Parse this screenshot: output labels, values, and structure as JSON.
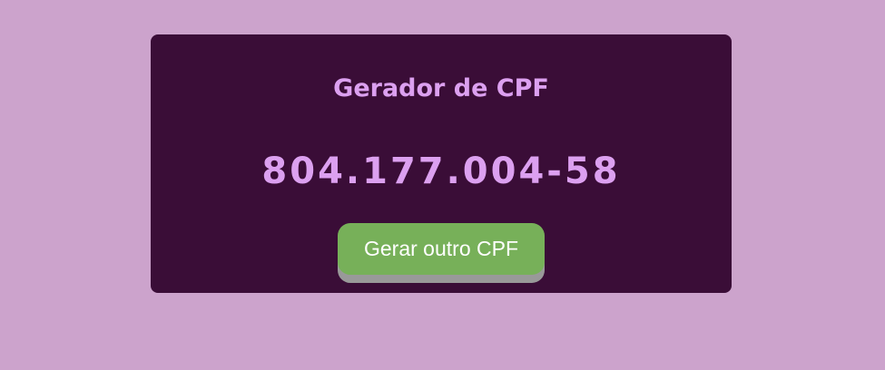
{
  "card": {
    "title": "Gerador de CPF",
    "cpf_value": "804.177.004-58",
    "generate_button_label": "Gerar outro CPF"
  },
  "colors": {
    "background": "#cca3cc",
    "card": "#3a0d37",
    "text_accent": "#dca0f0",
    "button": "#77b059",
    "button_shadow": "#999999"
  }
}
